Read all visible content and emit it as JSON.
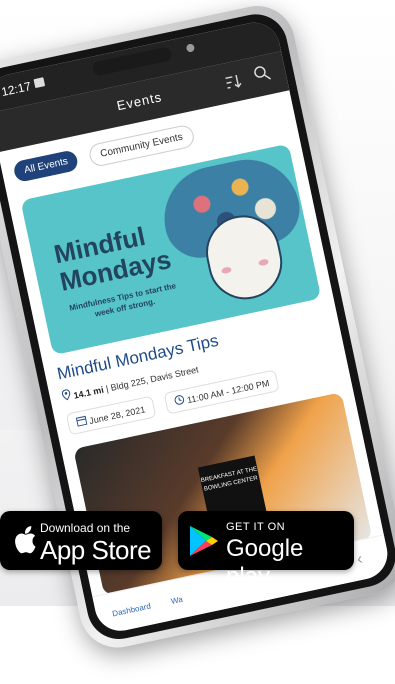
{
  "background": {
    "partial_text": "g"
  },
  "status_bar": {
    "time": "12:17"
  },
  "app": {
    "title": "Events",
    "filters": [
      {
        "label": "All Events",
        "active": true
      },
      {
        "label": "Community Events",
        "active": false
      }
    ]
  },
  "featured_event": {
    "banner_title": "Mindful Mondays",
    "banner_subtitle": "Mindfulness Tips to start the week off strong.",
    "title": "Mindful Mondays Tips",
    "distance": "14.1 mi",
    "location": "| Bldg 225, Davis Street",
    "date": "June 28, 2021",
    "time": "11:00 AM - 12:00 PM"
  },
  "second_event": {
    "banner_text": "BREAKFAST AT THE BOWLING CENTER"
  },
  "bottom_nav": {
    "items": [
      {
        "label": "Dashboard"
      },
      {
        "label": "Wa"
      }
    ]
  },
  "badges": {
    "apple": {
      "top": "Download on the",
      "bottom": "App Store"
    },
    "google": {
      "top": "GET IT ON",
      "bottom": "Google play"
    }
  },
  "colors": {
    "accent": "#20427a",
    "teal": "#56c4c8",
    "title_blue": "#1f4b87"
  }
}
